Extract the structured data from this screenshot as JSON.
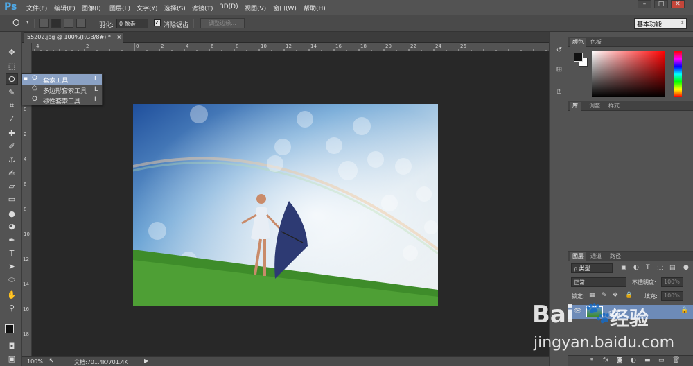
{
  "app": {
    "logo": "Ps"
  },
  "menu": [
    "文件(F)",
    "编辑(E)",
    "图像(I)",
    "图层(L)",
    "文字(Y)",
    "选择(S)",
    "滤镜(T)",
    "3D(D)",
    "视图(V)",
    "窗口(W)",
    "帮助(H)"
  ],
  "window_controls": [
    "–",
    "□",
    "✕"
  ],
  "options": {
    "feather_label": "羽化:",
    "feather_value": "0 像素",
    "antialias_label": "消除锯齿",
    "antialias_checked": true,
    "refine_edge_label": "调整边缘...",
    "workspace": "基本功能"
  },
  "document": {
    "tab_title": "55202.jpg @ 100%(RGB/8#) *",
    "tab_close": "×"
  },
  "ruler_top": [
    "4",
    "2",
    "0",
    "2",
    "4",
    "6",
    "8",
    "10",
    "12",
    "14",
    "16",
    "18",
    "20",
    "22",
    "24",
    "26"
  ],
  "ruler_left": [
    "0",
    "2",
    "4",
    "6",
    "8",
    "10",
    "12",
    "14",
    "16",
    "18",
    "20"
  ],
  "flyout": [
    {
      "label": "套索工具",
      "shortcut": "L",
      "selected": true
    },
    {
      "label": "多边形套索工具",
      "shortcut": "L",
      "selected": false
    },
    {
      "label": "磁性套索工具",
      "shortcut": "L",
      "selected": false
    }
  ],
  "status": {
    "zoom": "100%",
    "doc_info": "文档:701.4K/701.4K"
  },
  "color_panel": {
    "tabs": [
      "颜色",
      "色板"
    ],
    "accent": "#ff0000"
  },
  "library_panel": {
    "tabs": [
      "库",
      "调整",
      "样式"
    ]
  },
  "layers_panel": {
    "tabs": [
      "图层",
      "通道",
      "路径"
    ],
    "filter_kind": "ρ 类型",
    "blend_mode": "正常",
    "opacity_label": "不透明度:",
    "opacity_value": "100%",
    "lock_label": "锁定:",
    "fill_label": "填充:",
    "fill_value": "100%",
    "layer_name": "背景"
  },
  "watermark": {
    "brand": "Bai",
    "brand_tail": "经验",
    "url": "jingyan.baidu.com"
  }
}
